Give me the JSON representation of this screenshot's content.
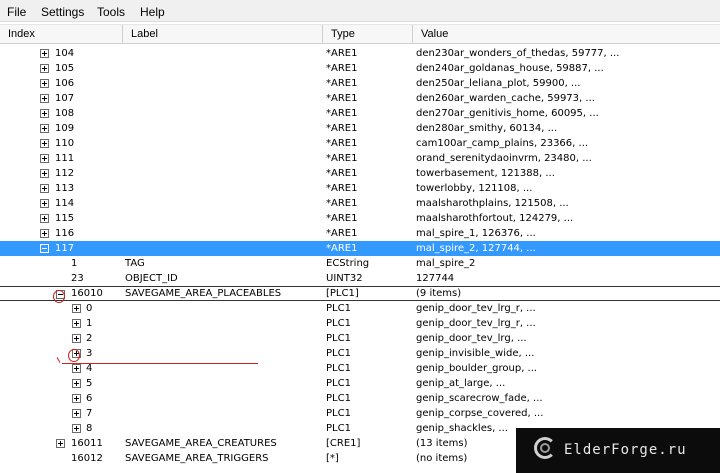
{
  "menu": {
    "file": "File",
    "settings": "Settings",
    "tools": "Tools",
    "help": "Help"
  },
  "columns": {
    "index": "Index",
    "label": "Label",
    "type": "Type",
    "value": "Value"
  },
  "rows": [
    {
      "index": "104",
      "label": "",
      "type": "*ARE1",
      "value": "den230ar_wonders_of_thedas, 59777, ..."
    },
    {
      "index": "105",
      "label": "",
      "type": "*ARE1",
      "value": "den240ar_goldanas_house, 59887, ..."
    },
    {
      "index": "106",
      "label": "",
      "type": "*ARE1",
      "value": "den250ar_leliana_plot, 59900, ..."
    },
    {
      "index": "107",
      "label": "",
      "type": "*ARE1",
      "value": "den260ar_warden_cache, 59973, ..."
    },
    {
      "index": "108",
      "label": "",
      "type": "*ARE1",
      "value": "den270ar_genitivis_home, 60095, ..."
    },
    {
      "index": "109",
      "label": "",
      "type": "*ARE1",
      "value": "den280ar_smithy, 60134, ..."
    },
    {
      "index": "110",
      "label": "",
      "type": "*ARE1",
      "value": "cam100ar_camp_plains, 23366, ..."
    },
    {
      "index": "111",
      "label": "",
      "type": "*ARE1",
      "value": "orand_serenitydaoinvrm, 23480, ..."
    },
    {
      "index": "112",
      "label": "",
      "type": "*ARE1",
      "value": "towerbasement, 121388, ..."
    },
    {
      "index": "113",
      "label": "",
      "type": "*ARE1",
      "value": "towerlobby, 121108, ..."
    },
    {
      "index": "114",
      "label": "",
      "type": "*ARE1",
      "value": "maalsharothplains, 121508, ..."
    },
    {
      "index": "115",
      "label": "",
      "type": "*ARE1",
      "value": "maalsharothfortout, 124279, ..."
    },
    {
      "index": "116",
      "label": "",
      "type": "*ARE1",
      "value": "mal_spire_1, 126376, ..."
    },
    {
      "index": "117",
      "label": "",
      "type": "*ARE1",
      "value": "mal_spire_2, 127744, ...",
      "selected": true,
      "expanded": true
    },
    {
      "index": "1",
      "label": "TAG",
      "type": "ECString",
      "value": "mal_spire_2",
      "leaf": true
    },
    {
      "index": "23",
      "label": "OBJECT_ID",
      "type": "UINT32",
      "value": "127744",
      "leaf": true
    },
    {
      "index": "16010",
      "label": "SAVEGAME_AREA_PLACEABLES",
      "type": "[PLC1]",
      "value": "(9 items)",
      "expanded": true,
      "framed": true
    },
    {
      "index": "0",
      "label": "",
      "type": "PLC1",
      "value": "genip_door_tev_lrg_r, ..."
    },
    {
      "index": "1",
      "label": "",
      "type": "PLC1",
      "value": "genip_door_tev_lrg_r, ..."
    },
    {
      "index": "2",
      "label": "",
      "type": "PLC1",
      "value": "genip_door_tev_lrg, ..."
    },
    {
      "index": "3",
      "label": "",
      "type": "PLC1",
      "value": "genip_invisible_wide, ..."
    },
    {
      "index": "4",
      "label": "",
      "type": "PLC1",
      "value": "genip_boulder_group, ..."
    },
    {
      "index": "5",
      "label": "",
      "type": "PLC1",
      "value": "genip_at_large, ..."
    },
    {
      "index": "6",
      "label": "",
      "type": "PLC1",
      "value": "genip_scarecrow_fade, ..."
    },
    {
      "index": "7",
      "label": "",
      "type": "PLC1",
      "value": "genip_corpse_covered, ..."
    },
    {
      "index": "8",
      "label": "",
      "type": "PLC1",
      "value": "genip_shackles, ..."
    },
    {
      "index": "16011",
      "label": "SAVEGAME_AREA_CREATURES",
      "type": "[CRE1]",
      "value": "(13 items)"
    },
    {
      "index": "16012",
      "label": "SAVEGAME_AREA_TRIGGERS",
      "type": "[*]",
      "value": "(no items)",
      "leaf": true
    }
  ],
  "watermark": {
    "text": "ElderForge.ru"
  },
  "colors": {
    "selection": "#3399ff",
    "annotation": "#d02020"
  },
  "icons": {
    "expand": "plus-box-icon",
    "collapse": "minus-box-icon"
  }
}
